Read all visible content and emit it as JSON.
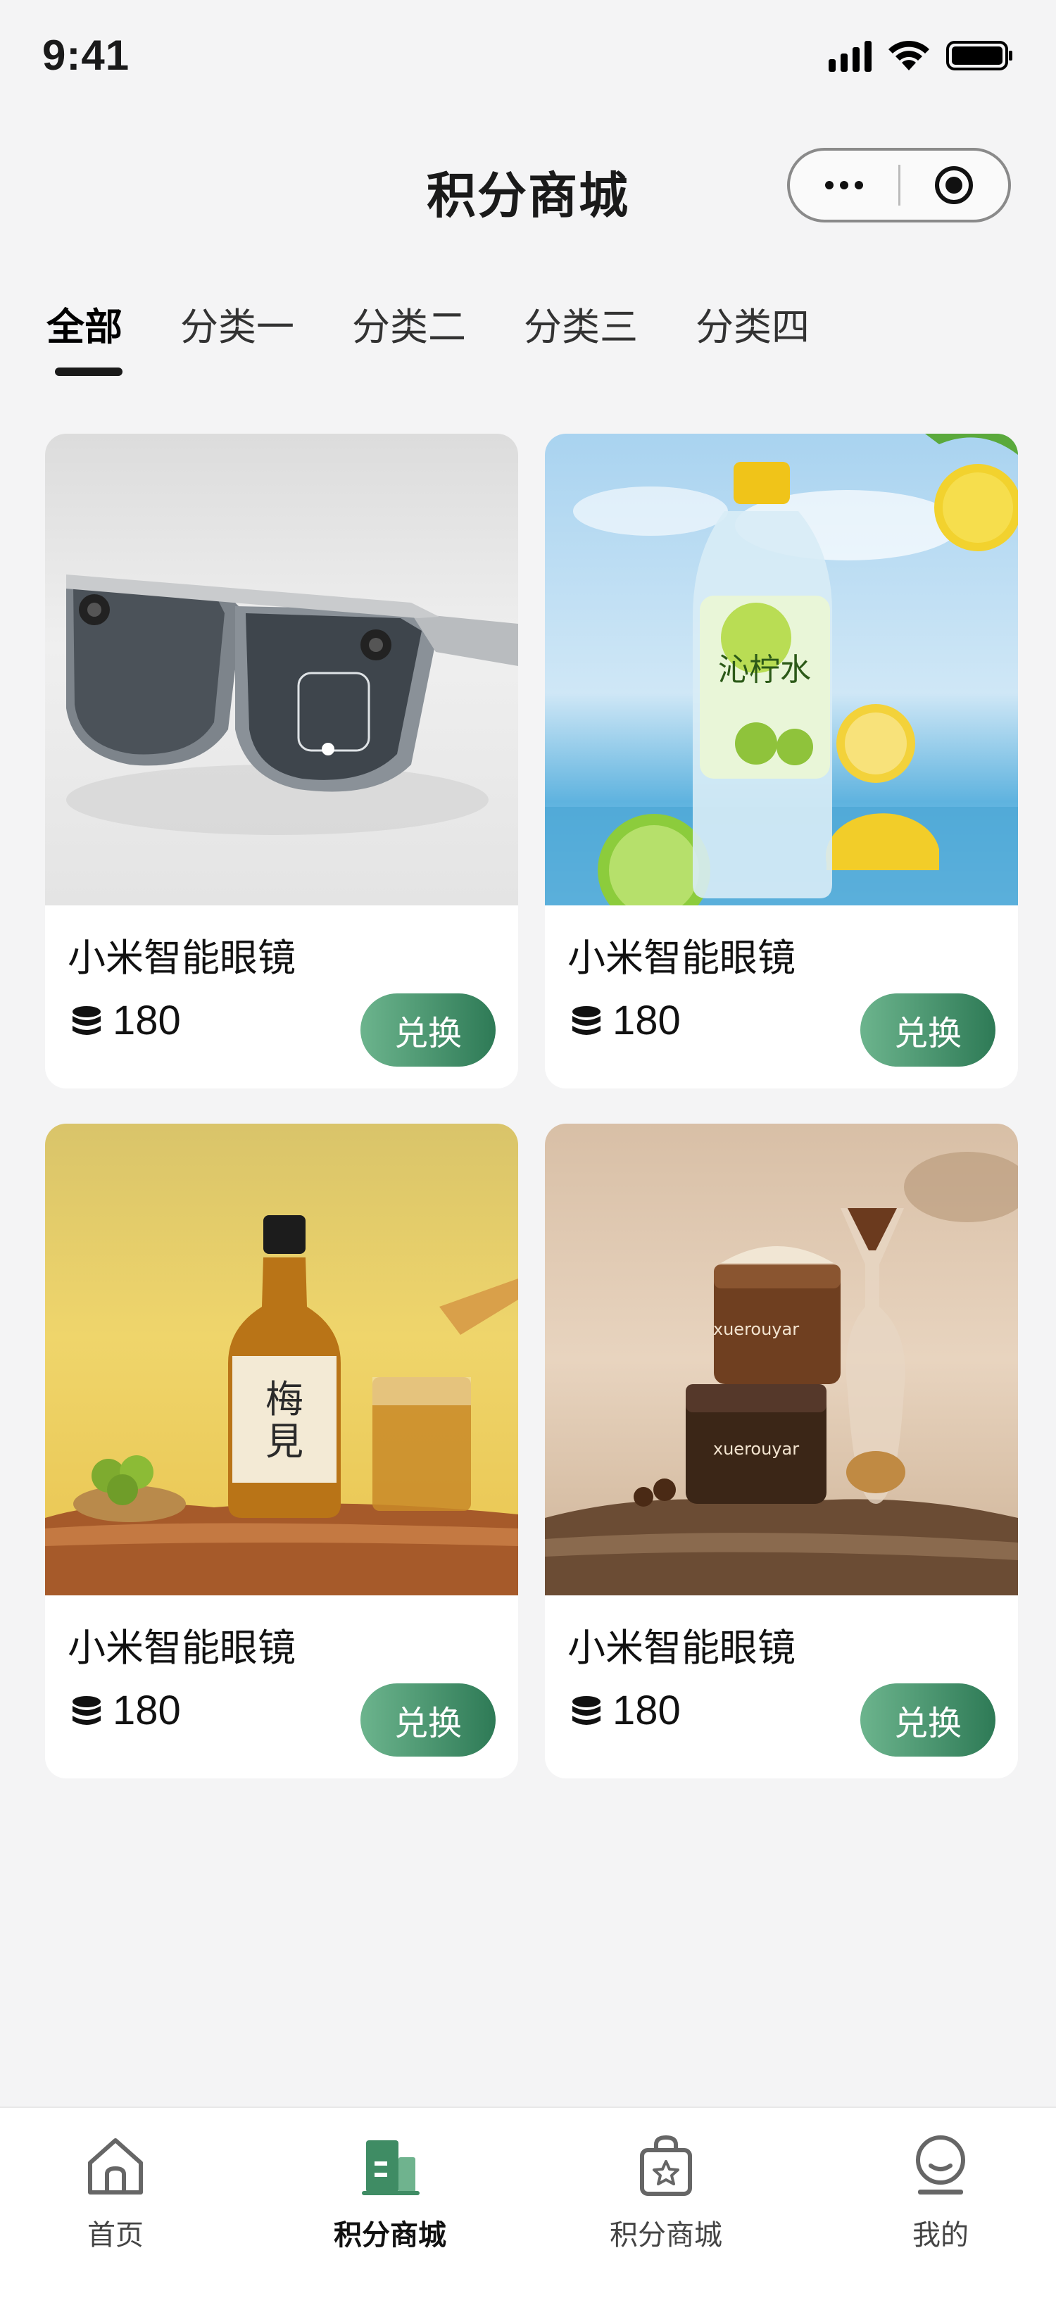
{
  "status_bar": {
    "time": "9:41",
    "signal_icon": "signal-icon",
    "wifi_icon": "wifi-icon",
    "battery_icon": "battery-icon"
  },
  "header": {
    "title": "积分商城",
    "more_icon": "more-dots-icon",
    "close_icon": "target-circle-icon"
  },
  "tabs": [
    {
      "label": "全部",
      "active": true
    },
    {
      "label": "分类一",
      "active": false
    },
    {
      "label": "分类二",
      "active": false
    },
    {
      "label": "分类三",
      "active": false
    },
    {
      "label": "分类四",
      "active": false
    }
  ],
  "products": [
    {
      "name": "小米智能眼镜",
      "points": "180",
      "button": "兑换",
      "image": "smart-glasses-photo"
    },
    {
      "name": "小米智能眼镜",
      "points": "180",
      "button": "兑换",
      "image": "lemon-water-bottle-photo"
    },
    {
      "name": "小米智能眼镜",
      "points": "180",
      "button": "兑换",
      "image": "plum-wine-bottle-photo"
    },
    {
      "name": "小米智能眼镜",
      "points": "180",
      "button": "兑换",
      "image": "eye-cream-jars-photo"
    }
  ],
  "bottom_nav": [
    {
      "label": "首页",
      "icon": "home-icon",
      "active": false
    },
    {
      "label": "积分商城",
      "icon": "building-icon",
      "active": true
    },
    {
      "label": "积分商城",
      "icon": "shopping-bag-star-icon",
      "active": false
    },
    {
      "label": "我的",
      "icon": "user-face-icon",
      "active": false
    }
  ],
  "colors": {
    "accent": "#3f8c64",
    "background": "#f4f4f5"
  }
}
